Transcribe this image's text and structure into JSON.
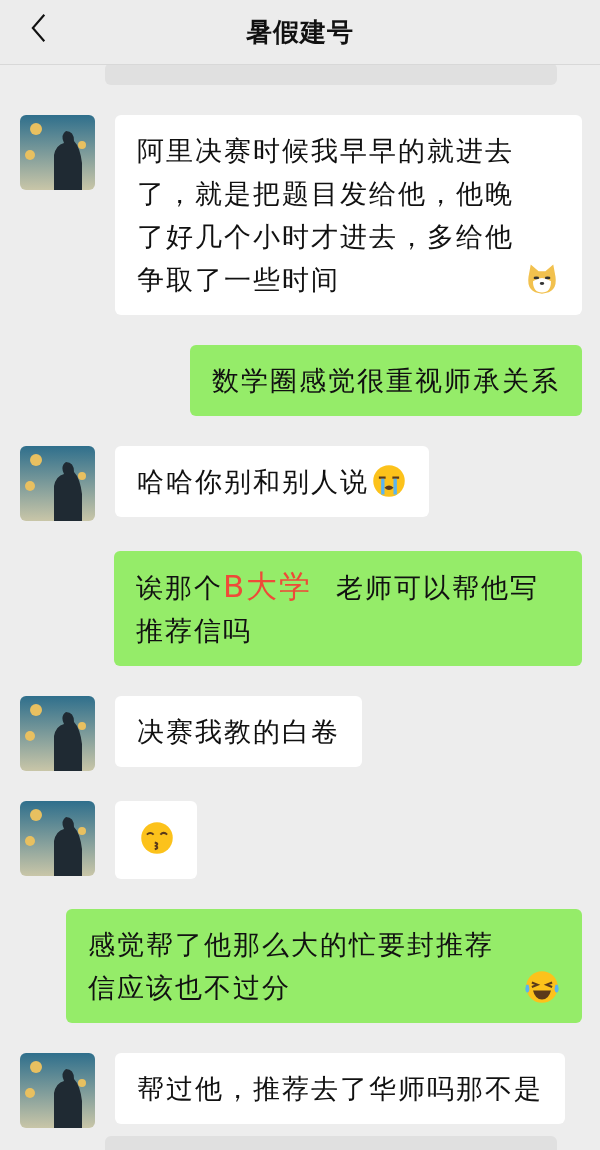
{
  "header": {
    "title": "暑假建号"
  },
  "messages": [
    {
      "outgoing": false,
      "kind": "blank"
    },
    {
      "outgoing": false,
      "kind": "text",
      "text": "阿里决赛时候我早早的就进去了，就是把题目发给他，他晚了好几个小时才进去，多给他争取了一些时间",
      "emoji": {
        "kind": "dog"
      }
    },
    {
      "outgoing": true,
      "kind": "text",
      "text": "数学圈感觉很重视师承关系"
    },
    {
      "outgoing": false,
      "kind": "text",
      "text": "哈哈你别和别人说",
      "emoji": {
        "kind": "crying"
      }
    },
    {
      "outgoing": true,
      "kind": "parts",
      "parts": [
        {
          "kind": "plain",
          "text": "诶那个"
        },
        {
          "kind": "annotation",
          "text": "B大学"
        },
        {
          "kind": "plain",
          "text": "老师可以帮他写推荐信吗"
        }
      ]
    },
    {
      "outgoing": false,
      "kind": "text",
      "text": "决赛我教的白卷"
    },
    {
      "outgoing": false,
      "kind": "emoji",
      "emoji": {
        "kind": "kissing"
      }
    },
    {
      "outgoing": true,
      "kind": "text",
      "text": "感觉帮了他那么大的忙要封推荐信应该也不过分",
      "emoji": {
        "kind": "laughing"
      }
    },
    {
      "outgoing": false,
      "kind": "text",
      "text": "帮过他，推荐去了华师吗那不是"
    },
    {
      "outgoing": false,
      "kind": "blank"
    }
  ]
}
